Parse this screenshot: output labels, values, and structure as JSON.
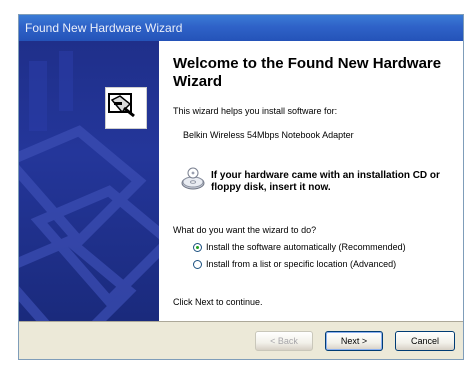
{
  "window": {
    "title": "Found New Hardware Wizard"
  },
  "content": {
    "heading": "Welcome to the Found New Hardware Wizard",
    "intro": "This wizard helps you install software for:",
    "device": "Belkin Wireless 54Mbps Notebook Adapter",
    "cd_prompt": "If your hardware came with an installation CD or floppy disk, insert it now.",
    "question": "What do you want the wizard to do?",
    "options": [
      {
        "label": "Install the software automatically (Recommended)",
        "selected": true
      },
      {
        "label": "Install from a list or specific location (Advanced)",
        "selected": false
      }
    ],
    "continue": "Click Next to continue."
  },
  "buttons": {
    "back": "< Back",
    "next": "Next >",
    "cancel": "Cancel"
  },
  "icons": {
    "wizard": "hardware-wizard-icon",
    "cd": "cd-disc-icon"
  },
  "colors": {
    "titlebar": "#2f62c8",
    "left_panel": "#1f2f8a",
    "dialog_bg": "#ece9d8"
  }
}
